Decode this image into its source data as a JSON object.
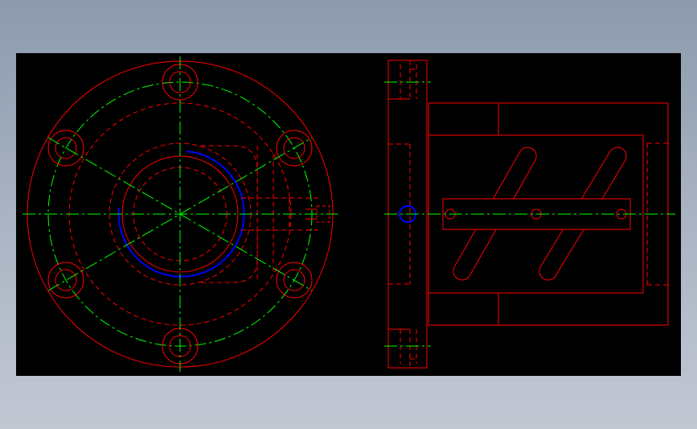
{
  "viewer": {
    "background": "#000000",
    "page_background_top": "#8c9aad",
    "page_background_bottom": "#c2c8d3"
  },
  "drawing": {
    "views": [
      "front-view",
      "side-view"
    ],
    "layer_colors": {
      "outline": "#ff0000",
      "center_lines": "#00ff00",
      "highlight_arc": "#0000ff"
    },
    "bolt_hole_count": 6
  }
}
